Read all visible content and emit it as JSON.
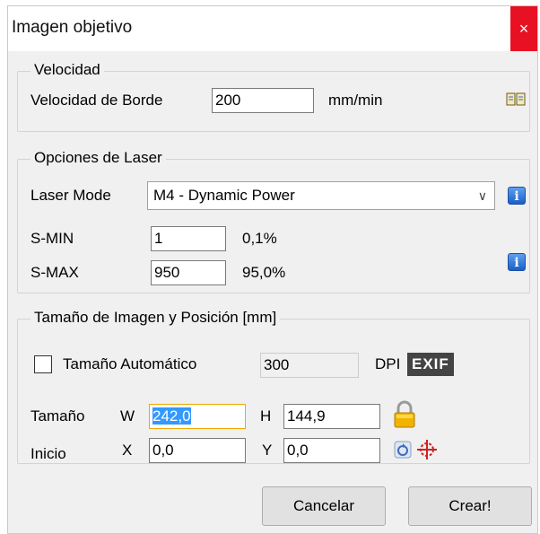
{
  "window": {
    "title": "Imagen objetivo",
    "close_glyph": "×"
  },
  "velocidad": {
    "legend": "Velocidad",
    "label": "Velocidad de Borde",
    "value": "200",
    "unit": "mm/min",
    "help_icon": "book-icon"
  },
  "laser": {
    "legend": "Opciones de Laser",
    "mode_label": "Laser Mode",
    "mode_value": "M4 - Dynamic Power",
    "smin_label": "S-MIN",
    "smin_value": "1",
    "smin_percent": "0,1%",
    "smax_label": "S-MAX",
    "smax_value": "950",
    "smax_percent": "95,0%",
    "info_glyph": "i"
  },
  "imagen": {
    "legend": "Tamaño de Imagen y Posición [mm]",
    "auto_size_label": "Tamaño Automático",
    "auto_size_checked": false,
    "dpi_value": "300",
    "dpi_label": "DPI",
    "exif_label": "EXIF",
    "size_label": "Tamaño",
    "w_label": "W",
    "w_value": "242,0",
    "h_label": "H",
    "h_value": "144,9",
    "start_label": "Inicio",
    "x_label": "X",
    "x_value": "0,0",
    "y_label": "Y",
    "y_value": "0,0"
  },
  "buttons": {
    "cancel": "Cancelar",
    "create": "Crear!"
  },
  "colors": {
    "close_bg": "#e81123",
    "info_blue": "#1a5fc8",
    "selection": "#3399ff",
    "lock_gold": "#f0b400",
    "target_red": "#d02020"
  }
}
